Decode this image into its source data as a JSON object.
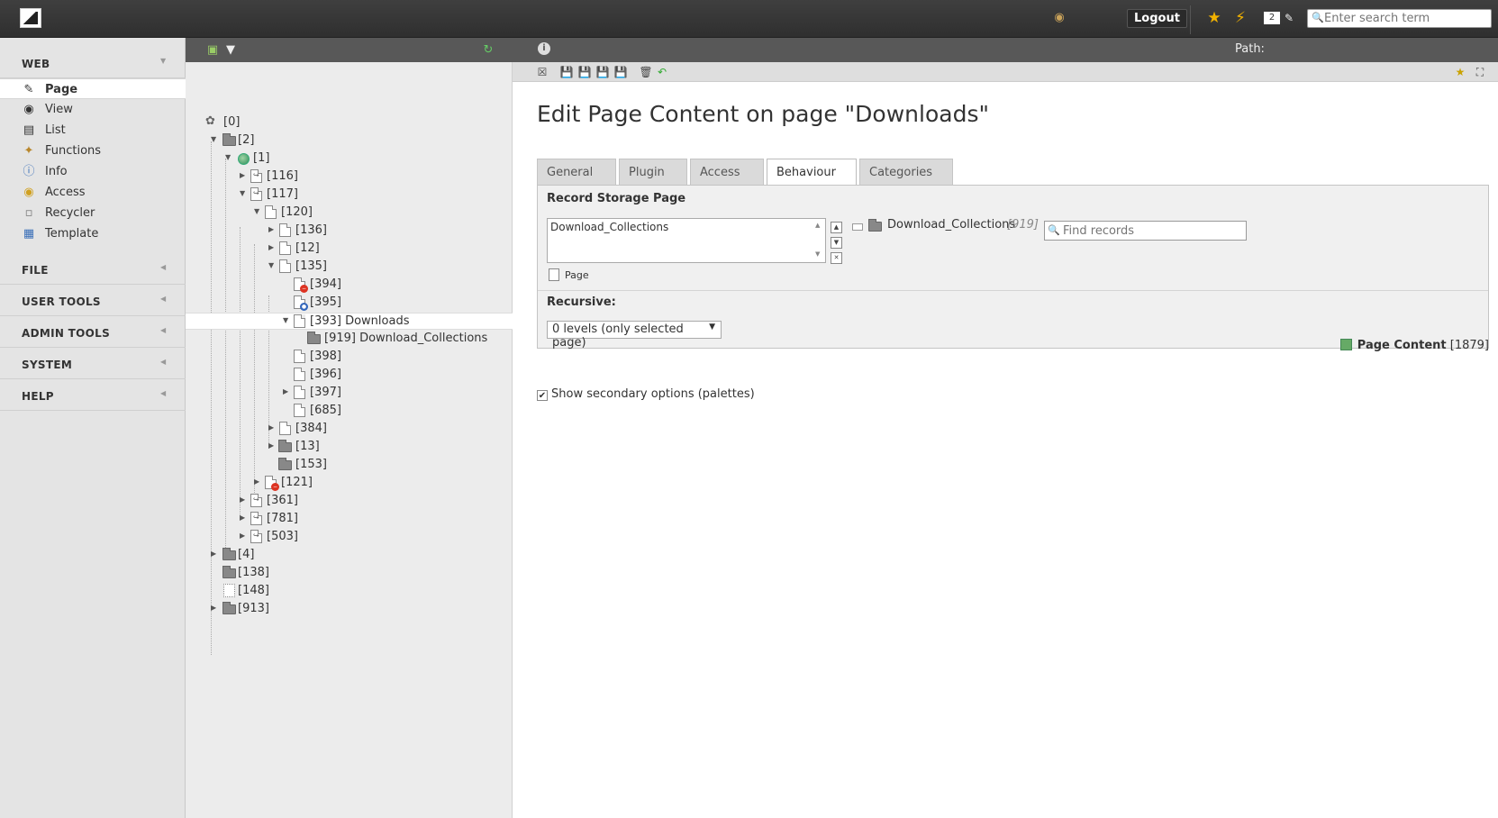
{
  "topbar": {
    "logout_label": "Logout",
    "workspace_count": "2",
    "search_placeholder": "Enter search term"
  },
  "modules": {
    "web_label": "WEB",
    "web_items": [
      {
        "label": "Page",
        "icon": "page-icon"
      },
      {
        "label": "View",
        "icon": "eye-icon"
      },
      {
        "label": "List",
        "icon": "list-icon"
      },
      {
        "label": "Functions",
        "icon": "wand-icon"
      },
      {
        "label": "Info",
        "icon": "info-icon"
      },
      {
        "label": "Access",
        "icon": "lock-icon"
      },
      {
        "label": "Recycler",
        "icon": "trash-icon"
      },
      {
        "label": "Template",
        "icon": "template-icon"
      }
    ],
    "file_label": "FILE",
    "user_tools_label": "USER TOOLS",
    "admin_tools_label": "ADMIN TOOLS",
    "system_label": "SYSTEM",
    "help_label": "HELP"
  },
  "tree": [
    {
      "label": "[0]"
    },
    {
      "label": "[2]"
    },
    {
      "label": "[1]"
    },
    {
      "label": "[116]"
    },
    {
      "label": "[117]"
    },
    {
      "label": "[120]"
    },
    {
      "label": "[136]"
    },
    {
      "label": "[12]"
    },
    {
      "label": "[135]"
    },
    {
      "label": "[394]"
    },
    {
      "label": "[395]"
    },
    {
      "label": "[393] Downloads"
    },
    {
      "label": "[919] Download_Collections"
    },
    {
      "label": "[398]"
    },
    {
      "label": "[396]"
    },
    {
      "label": "[397]"
    },
    {
      "label": "[685]"
    },
    {
      "label": "[384]"
    },
    {
      "label": "[13]"
    },
    {
      "label": "[153]"
    },
    {
      "label": "[121]"
    },
    {
      "label": "[361]"
    },
    {
      "label": "[781]"
    },
    {
      "label": "[503]"
    },
    {
      "label": "[4]"
    },
    {
      "label": "[138]"
    },
    {
      "label": "[148]"
    },
    {
      "label": "[913]"
    }
  ],
  "content": {
    "path_label": "Path:",
    "title": "Edit Page Content on page \"Downloads\"",
    "tabs": [
      "General",
      "Plugin",
      "Access",
      "Behaviour",
      "Categories"
    ],
    "active_tab": "Behaviour",
    "record_storage_label": "Record Storage Page",
    "selected_item": "Download_Collections",
    "browser_item_label": "Download_Collections",
    "browser_item_uid": "[919]",
    "find_records_placeholder": "Find records",
    "table_label": "Page",
    "recursive_label": "Recursive:",
    "recursive_value": "0 levels (only selected page)",
    "record_info_title": "Page Content",
    "record_info_uid": "[1879]",
    "secondary_options_label": "Show secondary options (palettes)"
  }
}
